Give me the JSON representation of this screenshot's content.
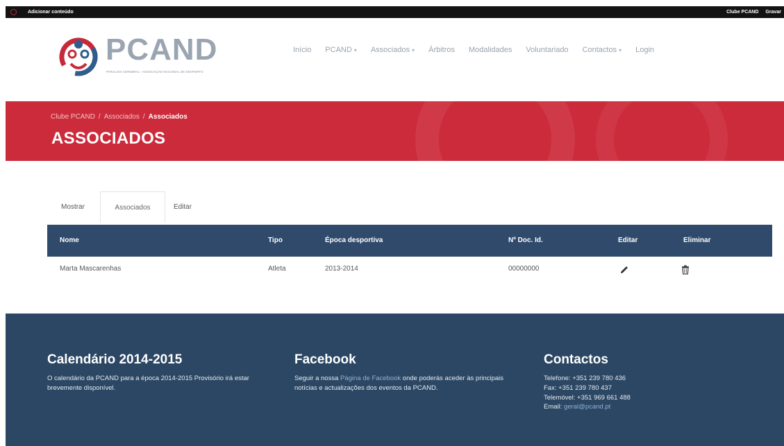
{
  "admin_bar": {
    "left_label": "Adicionar conteúdo",
    "right_items": [
      "Clube PCAND",
      "Gravar"
    ]
  },
  "header": {
    "logo_title": "PCAND",
    "logo_subtitle": "PARALISIA CEREBRAL - ASSOCIAÇÃO NACIONAL DE DESPORTO",
    "nav": [
      {
        "label": "Início",
        "dropdown": false
      },
      {
        "label": "PCAND",
        "dropdown": true
      },
      {
        "label": "Associados",
        "dropdown": true
      },
      {
        "label": "Árbitros",
        "dropdown": false
      },
      {
        "label": "Modalidades",
        "dropdown": false
      },
      {
        "label": "Voluntariado",
        "dropdown": false
      },
      {
        "label": "Contactos",
        "dropdown": true
      },
      {
        "label": "Login",
        "dropdown": false
      }
    ],
    "caret": "▾"
  },
  "banner": {
    "breadcrumb": [
      "Clube PCAND",
      "Associados",
      "Associados"
    ],
    "separator": "/",
    "title": "ASSOCIADOS"
  },
  "tabs": [
    {
      "label": "Mostrar",
      "active": false
    },
    {
      "label": "Associados",
      "active": true
    },
    {
      "label": "Editar",
      "active": false
    }
  ],
  "table": {
    "headers": [
      "Nome",
      "Tipo",
      "Época desportiva",
      "Nº Doc. Id.",
      "Editar",
      "Eliminar"
    ],
    "rows": [
      {
        "nome": "Marta Mascarenhas",
        "tipo": "Atleta",
        "epoca": "2013-2014",
        "doc": "00000000",
        "edit_icon": "pencil-icon",
        "delete_icon": "trash-icon"
      }
    ]
  },
  "footer": {
    "calendar": {
      "title": "Calendário 2014-2015",
      "text": "O calendário da PCAND para a época 2014-2015 Provisório irá estar brevemente disponível."
    },
    "facebook": {
      "title": "Facebook",
      "text_before": "Seguir a nossa ",
      "link": "Página de Facebook",
      "text_after": " onde poderás aceder às principais notícias e actualizações dos eventos da PCAND."
    },
    "contacts": {
      "title": "Contactos",
      "phone": "Telefone: +351 239 780 436",
      "fax": "Fax: +351 239 780 437",
      "mobile": "Telemóvel: +351 969 661 488",
      "email_label": "Email:",
      "email": "geral@pcand.pt"
    }
  },
  "colors": {
    "banner_red": "#cc2b3b",
    "table_header": "#2f4a6b",
    "footer_bg": "#2c4764",
    "link": "#8fb3d7"
  }
}
